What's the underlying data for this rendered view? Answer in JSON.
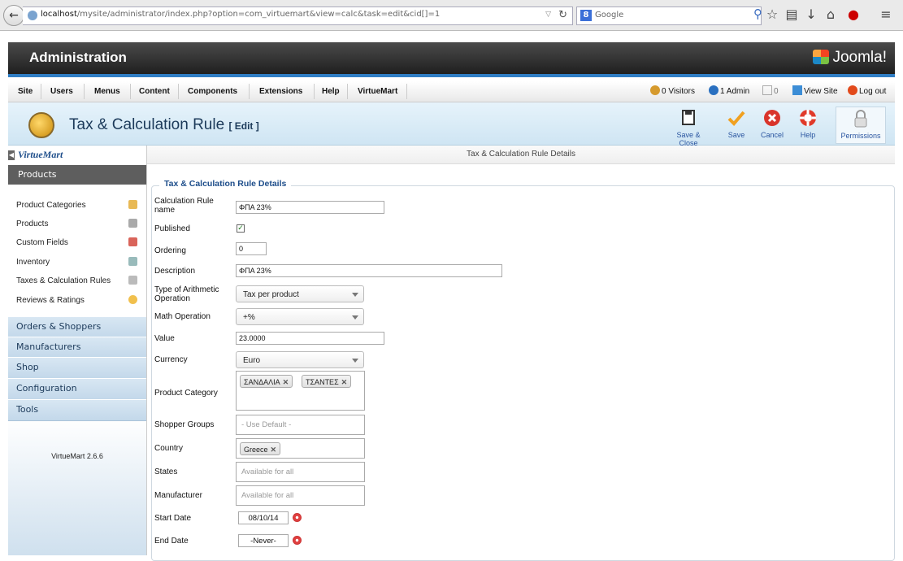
{
  "browser": {
    "url_host": "localhost",
    "url_path": "/mysite/administrator/index.php?option=com_virtuemart&view=calc&task=edit&cid[]=1",
    "search_placeholder": "Google",
    "search_engine_badge": "8"
  },
  "admin_header": {
    "title": "Administration",
    "brand": "Joomla!"
  },
  "menu": {
    "items": [
      "Site",
      "Users",
      "Menus",
      "Content",
      "Components",
      "Extensions",
      "Help",
      "VirtueMart"
    ],
    "status": {
      "visitors": "0 Visitors",
      "admin": "1 Admin",
      "messages": "0",
      "view_site": "View Site",
      "logout": "Log out"
    }
  },
  "page": {
    "title": "Tax & Calculation Rule",
    "title_suffix": "[ Edit ]"
  },
  "toolbar": {
    "save_close": "Save & Close",
    "save": "Save",
    "cancel": "Cancel",
    "help": "Help",
    "permissions": "Permissions"
  },
  "sidebar": {
    "logo": "VirtueMart",
    "active_section": "Products",
    "product_items": [
      "Product Categories",
      "Products",
      "Custom Fields",
      "Inventory",
      "Taxes & Calculation Rules",
      "Reviews & Ratings"
    ],
    "sections": [
      "Orders & Shoppers",
      "Manufacturers",
      "Shop",
      "Configuration",
      "Tools"
    ],
    "version": "VirtueMart 2.6.6"
  },
  "main": {
    "header": "Tax & Calculation Rule Details",
    "legend": "Tax & Calculation Rule Details",
    "labels": {
      "name": "Calculation Rule name",
      "published": "Published",
      "ordering": "Ordering",
      "description": "Description",
      "arith_type": "Type of Arithmetic Operation",
      "math_op": "Math Operation",
      "value": "Value",
      "currency": "Currency",
      "product_category": "Product Category",
      "shopper_groups": "Shopper Groups",
      "country": "Country",
      "states": "States",
      "manufacturer": "Manufacturer",
      "start_date": "Start Date",
      "end_date": "End Date"
    },
    "values": {
      "name": "ΦΠΑ 23%",
      "published": true,
      "ordering": "0",
      "description": "ΦΠΑ 23%",
      "arith_type": "Tax per product",
      "math_op": "+%",
      "value": "23.0000",
      "currency": "Euro",
      "product_categories": [
        "ΣΑΝΔΑΛΙΑ",
        "ΤΣΑΝΤΕΣ"
      ],
      "shopper_groups_placeholder": "- Use Default -",
      "countries": [
        "Greece"
      ],
      "states_placeholder": "Available for all",
      "manufacturer_placeholder": "Available for all",
      "start_date": "08/10/14",
      "end_date": "-Never-"
    }
  },
  "colors": {
    "accent": "#2f7dc4",
    "header_dark": "#2a2a2a",
    "legend_text": "#1d4d8a"
  }
}
